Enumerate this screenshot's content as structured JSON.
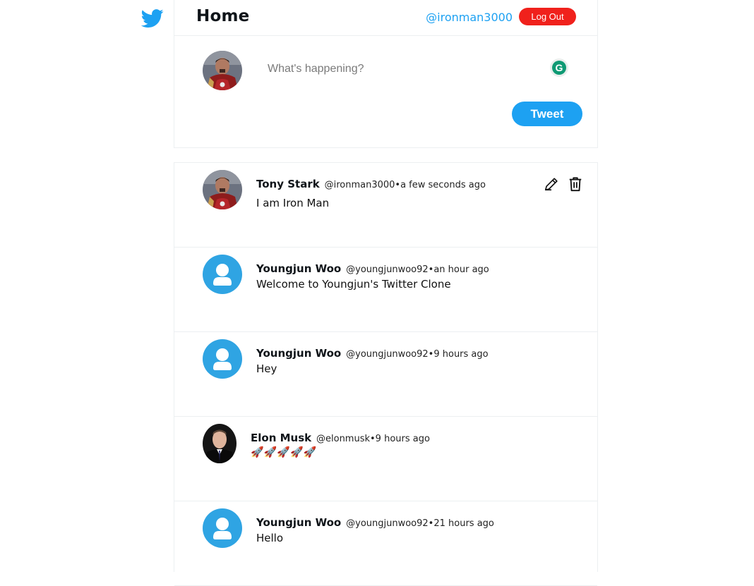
{
  "header": {
    "title": "Home",
    "user_handle": "@ironman3000",
    "logout_label": "Log Out"
  },
  "composer": {
    "placeholder": "What's happening?",
    "tweet_label": "Tweet"
  },
  "icons": {
    "logo": "twitter-bird-icon",
    "edit": "pencil-icon",
    "delete": "trash-icon",
    "grammarly": "grammarly-icon"
  },
  "colors": {
    "brand_blue": "#1da1f2",
    "logout_red": "#f0211c",
    "default_avatar": "#2fa4e3"
  },
  "tweets": [
    {
      "name": "Tony Stark",
      "meta": "@ironman3000•a few seconds ago",
      "text": "I am Iron Man",
      "avatar": "tony-stark-photo",
      "editable": true
    },
    {
      "name": "Youngjun Woo",
      "meta": "@youngjunwoo92•an hour ago",
      "text": "Welcome to Youngjun's Twitter Clone",
      "avatar": "default-user"
    },
    {
      "name": "Youngjun Woo",
      "meta": "@youngjunwoo92•9 hours ago",
      "text": "Hey",
      "avatar": "default-user"
    },
    {
      "name": "Elon Musk",
      "meta": "@elonmusk•9 hours ago",
      "text": "🚀🚀🚀🚀🚀",
      "avatar": "elon-musk-photo"
    },
    {
      "name": "Youngjun Woo",
      "meta": "@youngjunwoo92•21 hours ago",
      "text": "Hello",
      "avatar": "default-user"
    }
  ]
}
